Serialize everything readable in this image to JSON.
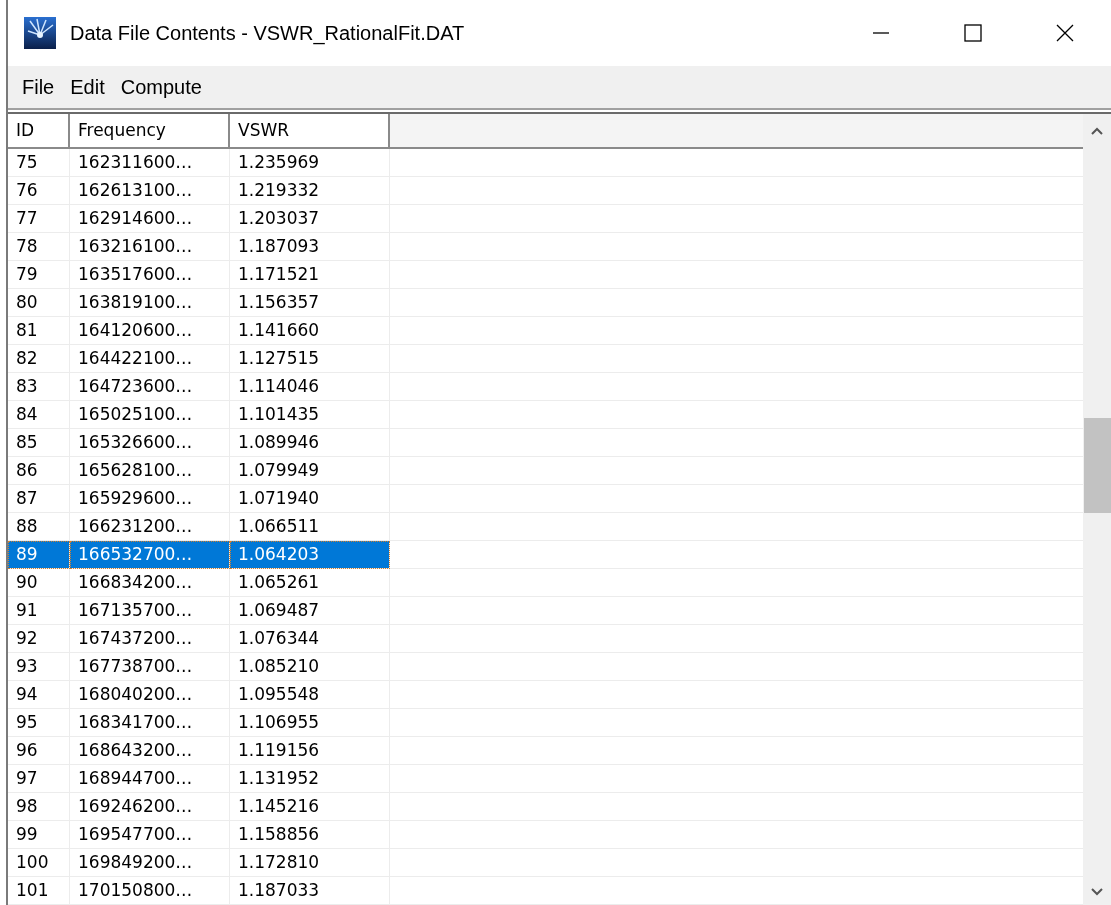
{
  "window": {
    "title": "Data File Contents - VSWR_RationalFit.DAT"
  },
  "menu": [
    "File",
    "Edit",
    "Compute"
  ],
  "table": {
    "columns": [
      "ID",
      "Frequency",
      "VSWR"
    ],
    "rows": [
      {
        "cells": [
          "75",
          "162311600…",
          "1.235969"
        ],
        "selected": false
      },
      {
        "cells": [
          "76",
          "162613100…",
          "1.219332"
        ],
        "selected": false
      },
      {
        "cells": [
          "77",
          "162914600…",
          "1.203037"
        ],
        "selected": false
      },
      {
        "cells": [
          "78",
          "163216100…",
          "1.187093"
        ],
        "selected": false
      },
      {
        "cells": [
          "79",
          "163517600…",
          "1.171521"
        ],
        "selected": false
      },
      {
        "cells": [
          "80",
          "163819100…",
          "1.156357"
        ],
        "selected": false
      },
      {
        "cells": [
          "81",
          "164120600…",
          "1.141660"
        ],
        "selected": false
      },
      {
        "cells": [
          "82",
          "164422100…",
          "1.127515"
        ],
        "selected": false
      },
      {
        "cells": [
          "83",
          "164723600…",
          "1.114046"
        ],
        "selected": false
      },
      {
        "cells": [
          "84",
          "165025100…",
          "1.101435"
        ],
        "selected": false
      },
      {
        "cells": [
          "85",
          "165326600…",
          "1.089946"
        ],
        "selected": false
      },
      {
        "cells": [
          "86",
          "165628100…",
          "1.079949"
        ],
        "selected": false
      },
      {
        "cells": [
          "87",
          "165929600…",
          "1.071940"
        ],
        "selected": false
      },
      {
        "cells": [
          "88",
          "166231200…",
          "1.066511"
        ],
        "selected": false
      },
      {
        "cells": [
          "89",
          "166532700…",
          "1.064203"
        ],
        "selected": true
      },
      {
        "cells": [
          "90",
          "166834200…",
          "1.065261"
        ],
        "selected": false
      },
      {
        "cells": [
          "91",
          "167135700…",
          "1.069487"
        ],
        "selected": false
      },
      {
        "cells": [
          "92",
          "167437200…",
          "1.076344"
        ],
        "selected": false
      },
      {
        "cells": [
          "93",
          "167738700…",
          "1.085210"
        ],
        "selected": false
      },
      {
        "cells": [
          "94",
          "168040200…",
          "1.095548"
        ],
        "selected": false
      },
      {
        "cells": [
          "95",
          "168341700…",
          "1.106955"
        ],
        "selected": false
      },
      {
        "cells": [
          "96",
          "168643200…",
          "1.119156"
        ],
        "selected": false
      },
      {
        "cells": [
          "97",
          "168944700…",
          "1.131952"
        ],
        "selected": false
      },
      {
        "cells": [
          "98",
          "169246200…",
          "1.145216"
        ],
        "selected": false
      },
      {
        "cells": [
          "99",
          "169547700…",
          "1.158856"
        ],
        "selected": false
      },
      {
        "cells": [
          "100",
          "169849200…",
          "1.172810"
        ],
        "selected": false
      },
      {
        "cells": [
          "101",
          "170150800…",
          "1.187033"
        ],
        "selected": false
      }
    ]
  }
}
